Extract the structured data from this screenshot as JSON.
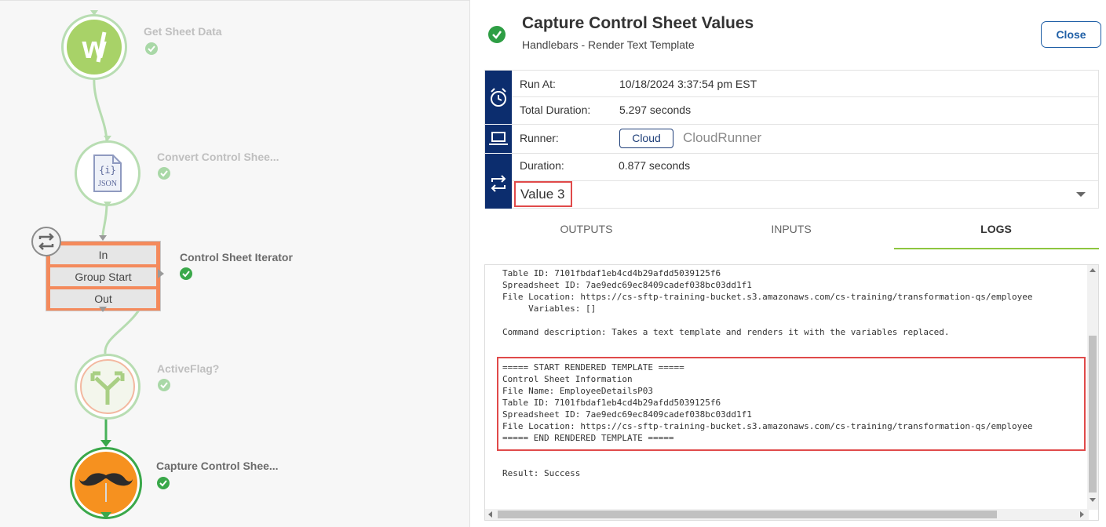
{
  "workflow": {
    "nodes": [
      {
        "label": "Get Sheet Data",
        "icon": "w-logo-icon"
      },
      {
        "label": "Convert Control Shee...",
        "icon": "json-file-icon",
        "icon_text": "JSON"
      },
      {
        "label": "Control Sheet Iterator",
        "icon": "loop-icon",
        "rows": [
          "In",
          "Group Start",
          "Out"
        ]
      },
      {
        "label": "ActiveFlag?",
        "icon": "branch-icon"
      },
      {
        "label": "Capture Control Shee...",
        "icon": "mustache-icon"
      }
    ]
  },
  "panel": {
    "title": "Capture Control Sheet Values",
    "subtitle": "Handlebars - Render Text Template",
    "close_label": "Close",
    "run_at_label": "Run At:",
    "run_at_value": "10/18/2024 3:37:54 pm EST",
    "total_duration_label": "Total Duration:",
    "total_duration_value": "5.297 seconds",
    "runner_label": "Runner:",
    "runner_badge": "Cloud",
    "runner_name": "CloudRunner",
    "duration_label": "Duration:",
    "duration_value": "0.877 seconds",
    "iteration_value": "Value 3",
    "tabs": [
      "OUTPUTS",
      "INPUTS",
      "LOGS"
    ],
    "active_tab": "LOGS",
    "colors": {
      "accent_green": "#8dc63f",
      "navy": "#0c2d6e",
      "highlight_red": "#e04a4a",
      "close_blue": "#1f5fa6"
    }
  },
  "logs": {
    "lines": [
      "Table ID: 7101fbdaf1eb4cd4b29afdd5039125f6",
      "Spreadsheet ID: 7ae9edc69ec8409cadef038bc03dd1f1",
      "File Location: https://cs-sftp-training-bucket.s3.amazonaws.com/cs-training/transformation-qs/employee",
      "     Variables: []",
      "",
      "Command description: Takes a text template and renders it with the variables replaced.",
      "",
      "",
      "===== START RENDERED TEMPLATE =====",
      "Control Sheet Information",
      "File Name: EmployeeDetailsP03",
      "Table ID: 7101fbdaf1eb4cd4b29afdd5039125f6",
      "Spreadsheet ID: 7ae9edc69ec8409cadef038bc03dd1f1",
      "File Location: https://cs-sftp-training-bucket.s3.amazonaws.com/cs-training/transformation-qs/employee",
      "===== END RENDERED TEMPLATE =====",
      "",
      "",
      "Result: Success"
    ]
  }
}
